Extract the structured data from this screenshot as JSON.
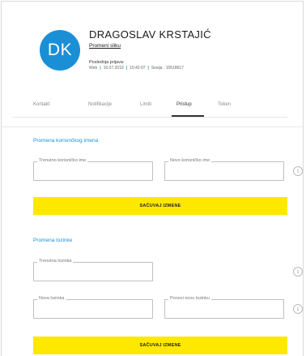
{
  "profile": {
    "initials": "DK",
    "name": "DRAGOSLAV KRSTAJIĆ",
    "change_photo_label": "Promeni sliku",
    "last_login_label": "Poslednja prijava:",
    "last_login": {
      "channel": "Web",
      "date": "16.07.2019",
      "time": "15:42:07",
      "session": "Sesija : 10518617"
    },
    "avatar_color": "#1b8fd6"
  },
  "tabs": [
    {
      "label": "Kontakt",
      "active": false
    },
    {
      "label": "Notifikacije",
      "active": false
    },
    {
      "label": "Limiti",
      "active": false
    },
    {
      "label": "Pristup",
      "active": true
    },
    {
      "label": "Token",
      "active": false
    }
  ],
  "username_section": {
    "title": "Promena korisničkog imena",
    "current_label": "Trenutno korisničko ime",
    "current_value": "",
    "new_label": "Novo korisničko ime",
    "new_value": "",
    "save_label": "SAČUVAJ IZMENE"
  },
  "password_section": {
    "title": "Promena lozinke",
    "current_label": "Trenutna lozinka",
    "new_label": "Nova lozinka",
    "repeat_label": "Ponovi novu lozinku",
    "save_label": "SAČUVAJ IZMENE"
  },
  "icons": {
    "info": "info-icon",
    "info_glyph": "i"
  },
  "colors": {
    "accent_blue": "#1b8fd6",
    "button_yellow": "#ffe800"
  }
}
